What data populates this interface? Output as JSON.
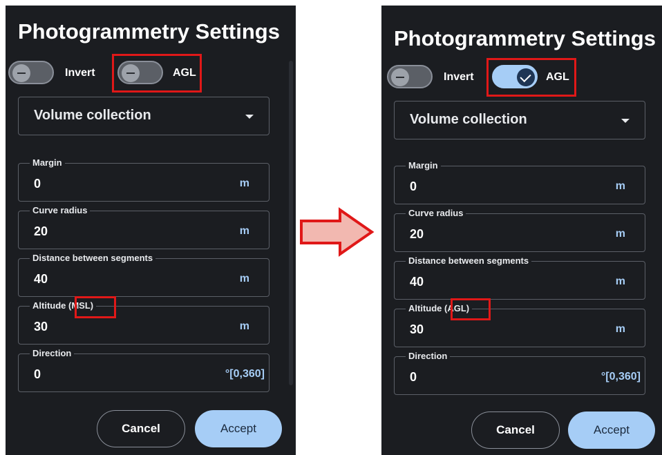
{
  "left_panel": {
    "title": "Photogrammetry Settings",
    "invert_label": "Invert",
    "agl_label": "AGL",
    "agl_on": false,
    "select_value": "Volume collection",
    "fields": [
      {
        "label": "Margin",
        "value": "0",
        "unit": "m"
      },
      {
        "label": "Curve radius",
        "value": "20",
        "unit": "m"
      },
      {
        "label": "Distance between segments",
        "value": "40",
        "unit": "m"
      },
      {
        "label": "Altitude ",
        "label_tag": "(MSL)",
        "value": "30",
        "unit": "m"
      },
      {
        "label": "Direction",
        "value": "0",
        "unit": "°[0,360]"
      }
    ],
    "cancel_label": "Cancel",
    "accept_label": "Accept"
  },
  "right_panel": {
    "title": "Photogrammetry Settings",
    "invert_label": "Invert",
    "agl_label": "AGL",
    "agl_on": true,
    "select_value": "Volume collection",
    "fields": [
      {
        "label": "Margin",
        "value": "0",
        "unit": "m"
      },
      {
        "label": "Curve radius",
        "value": "20",
        "unit": "m"
      },
      {
        "label": "Distance between segments",
        "value": "40",
        "unit": "m"
      },
      {
        "label": "Altitude ",
        "label_tag": "(AGL)",
        "value": "30",
        "unit": "m"
      },
      {
        "label": "Direction",
        "value": "0",
        "unit": "°[0,360]"
      }
    ],
    "cancel_label": "Cancel",
    "accept_label": "Accept"
  },
  "colors": {
    "panel_bg": "#1b1d21",
    "accent": "#a6cdf6",
    "highlight": "#e01818",
    "arrow_fill": "#f2b8b0",
    "arrow_stroke": "#e01818"
  },
  "icons": [
    "minus-icon",
    "check-icon",
    "chevron-down-icon",
    "right-arrow-icon"
  ]
}
